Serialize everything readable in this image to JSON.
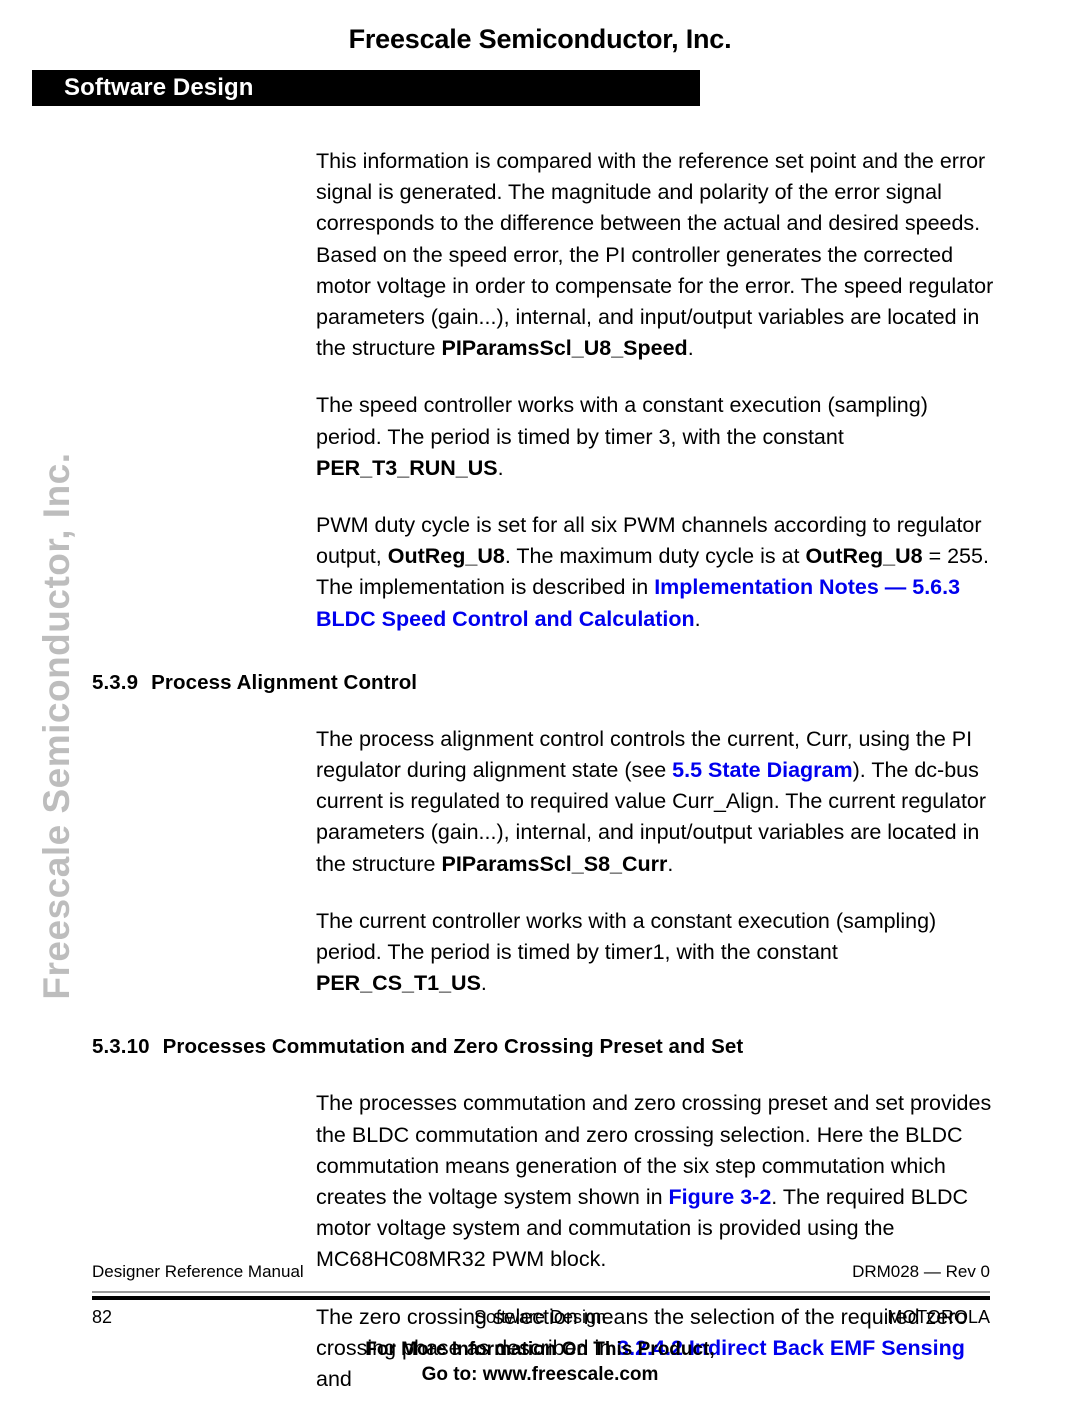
{
  "page": {
    "top_title": "Freescale Semiconductor, Inc.",
    "chapter_title": "Software Design",
    "side_watermark": "Freescale Semiconductor, Inc.",
    "link_color": "#0000ee",
    "chapter_bar_color": "#000000",
    "watermark_color": "#bdbdbd"
  },
  "body": {
    "p1": {
      "t1": "This information is compared with the reference set point and the error signal is generated. The magnitude and polarity of the error signal corresponds to the difference between the actual and desired speeds. Based on the speed error, the PI controller generates the corrected motor voltage in order to compensate for the error. The speed regulator parameters (gain...), internal, and input/output variables are located in the structure ",
      "b1": "PIParamsScl_U8_Speed",
      "t2": "."
    },
    "p2": {
      "t1": "The speed controller works with a constant execution (sampling) period. The period is timed by timer 3, with the constant ",
      "b1": "PER_T3_RUN_US",
      "t2": "."
    },
    "p3": {
      "t1": "PWM duty cycle is set for all six PWM channels according to regulator output, ",
      "b1": "OutReg_U8",
      "t2": ". The maximum duty cycle is at ",
      "b2": "OutReg_U8",
      "t3": " = 255. The implementation is described in ",
      "link1": "Implementation Notes — 5.6.3 BLDC Speed Control and Calculation",
      "t4": "."
    },
    "h_539": {
      "num": "5.3.9",
      "title": "Process Alignment Control"
    },
    "p4": {
      "t1": "The process alignment control controls the current, Curr, using the PI regulator during alignment state (see ",
      "link1": "5.5 State Diagram",
      "t2": "). The dc-bus current is regulated to required value Curr_Align. The current regulator parameters (gain...), internal, and input/output variables are located in the structure ",
      "b1": "PIParamsScl_S8_Curr",
      "t3": "."
    },
    "p5": {
      "t1": "The current controller works with a constant execution (sampling) period. The period is timed by timer1, with the constant ",
      "b1": "PER_CS_T1_US",
      "t2": "."
    },
    "h_5310": {
      "num": "5.3.10",
      "title": "Processes Commutation and Zero Crossing Preset and Set"
    },
    "p6": {
      "t1": "The processes commutation and zero crossing preset and set provides the BLDC commutation and zero crossing selection. Here the BLDC commutation means generation of the six step commutation which creates the voltage system shown in ",
      "link1": "Figure 3-2",
      "t2": ". The required BLDC motor voltage system and commutation is provided using the MC68HC08MR32 PWM block."
    },
    "p7": {
      "t1": "The zero crossing selection means the selection of the required zero crossing phase as described in ",
      "link1": "3.2.4.2 Indirect Back EMF Sensing",
      "t2": " and"
    }
  },
  "footer": {
    "manual_name": "Designer Reference Manual",
    "doc_rev": "DRM028 — Rev 0",
    "page_number": "82",
    "section_name": "Software Design",
    "brand": "MOTOROLA",
    "promo_line1": "For More Information On This Product,",
    "promo_line2": "Go to: www.freescale.com"
  }
}
